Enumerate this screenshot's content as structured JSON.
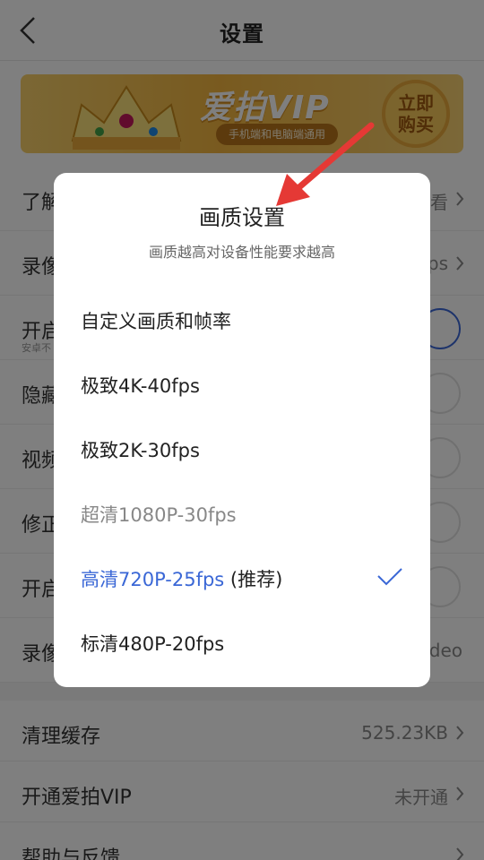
{
  "header": {
    "title": "设置"
  },
  "banner": {
    "title": "爱拍VIP",
    "subtitle": "手机端和电脑端通用",
    "buy_label": "立即购买"
  },
  "settings": [
    {
      "label": "了解",
      "value": "看",
      "kind": "link"
    },
    {
      "label": "录像",
      "value": "ps",
      "kind": "link"
    },
    {
      "label": "开启",
      "sublabel": "安卓不",
      "kind": "toggle",
      "on": true
    },
    {
      "label": "隐藏",
      "kind": "toggle",
      "on": false
    },
    {
      "label": "视频",
      "kind": "toggle",
      "on": false
    },
    {
      "label": "修正",
      "kind": "toggle",
      "on": false
    },
    {
      "label": "开启",
      "kind": "toggle",
      "on": false
    },
    {
      "label": "录像",
      "value": "deo",
      "kind": "value"
    }
  ],
  "settings_bottom": [
    {
      "label": "清理缓存",
      "value": "525.23KB"
    },
    {
      "label": "开通爱拍VIP",
      "value": "未开通"
    },
    {
      "label": "帮助与反馈",
      "value": ""
    }
  ],
  "dialog": {
    "title": "画质设置",
    "subtitle": "画质越高对设备性能要求越高",
    "options": [
      {
        "label": "自定义画质和帧率",
        "suffix": "",
        "state": "normal"
      },
      {
        "label": "极致4K-40fps",
        "suffix": "",
        "state": "normal"
      },
      {
        "label": "极致2K-30fps",
        "suffix": "",
        "state": "normal"
      },
      {
        "label": "超清1080P-30fps",
        "suffix": "",
        "state": "disabled"
      },
      {
        "label": "高清720P-25fps",
        "suffix": " (推荐)",
        "state": "selected"
      },
      {
        "label": "标清480P-20fps",
        "suffix": "",
        "state": "normal"
      }
    ]
  },
  "colors": {
    "accent": "#3a67d6",
    "arrow": "#e53935",
    "banner_gold": "#f2b53f"
  }
}
